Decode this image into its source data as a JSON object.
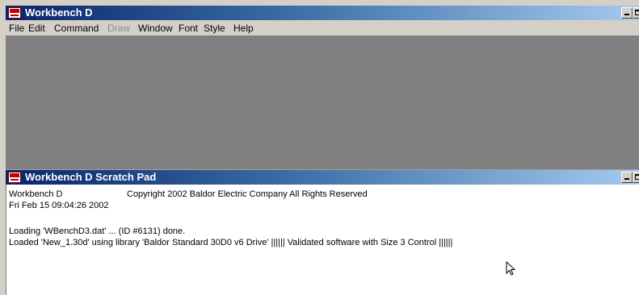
{
  "main_window": {
    "title": "Workbench D",
    "menu": [
      "File",
      "Edit",
      "Command",
      "Draw",
      "Window",
      "Font",
      "Style",
      "Help"
    ],
    "disabled_menu_items": [
      "Draw"
    ]
  },
  "scratch_pad": {
    "title": "Workbench D Scratch Pad",
    "app_name": "Workbench D",
    "copyright": "Copyright 2002 Baldor Electric Company All Rights Reserved",
    "timestamp": "Fri Feb 15 09:04:26 2002",
    "log_loading": "Loading 'WBenchD3.dat' ... (ID #6131) done.",
    "log_loaded": "Loaded 'New_1.30d' using library 'Baldor Standard 30D0 v6 Drive' |||||| Validated software with Size 3 Control ||||||"
  },
  "colors": {
    "title_gradient_start": "#0a246a",
    "title_gradient_end": "#a6caf0",
    "workspace": "#808080",
    "chrome": "#d4d0c8"
  },
  "icons": {
    "app": "workbench-app-icon",
    "minimize": "minimize-icon",
    "maximize": "maximize-icon",
    "cursor": "mouse-pointer-icon"
  }
}
